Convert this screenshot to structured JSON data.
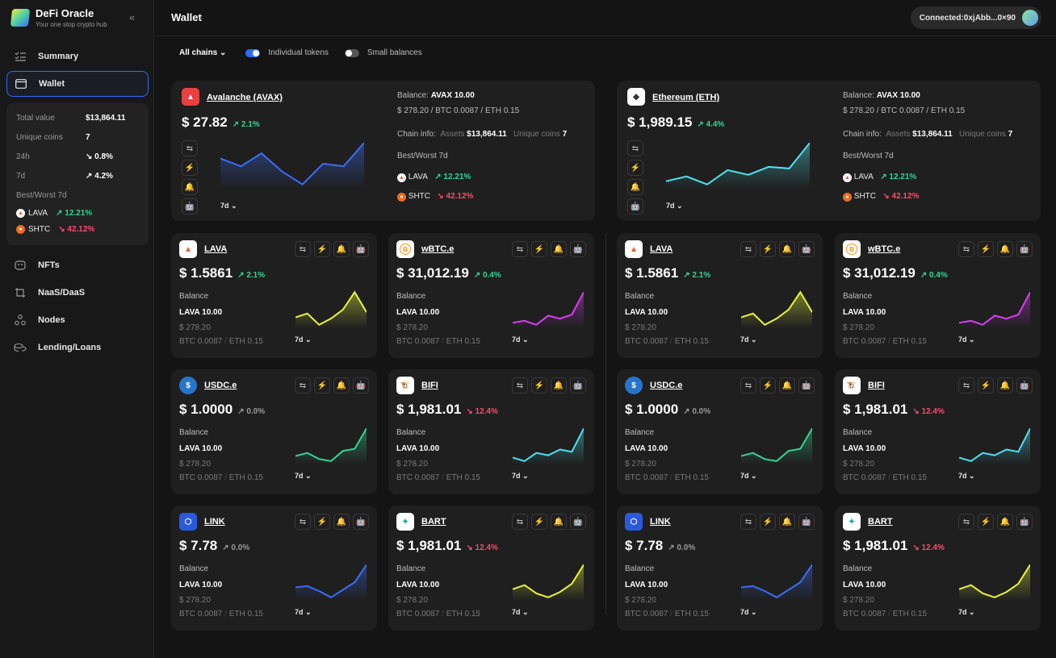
{
  "app": {
    "name": "DeFi Oracle",
    "tagline": "Your one stop crypto hub"
  },
  "nav": [
    {
      "label": "Summary",
      "icon": "checklist-icon"
    },
    {
      "label": "Wallet",
      "icon": "wallet-icon"
    },
    {
      "label": "NFTs",
      "icon": "nft-icon"
    },
    {
      "label": "NaaS/DaaS",
      "icon": "naas-icon"
    },
    {
      "label": "Nodes",
      "icon": "nodes-icon"
    },
    {
      "label": "Lending/Loans",
      "icon": "coins-icon"
    }
  ],
  "summary": {
    "total_label": "Total value",
    "total": "$13,864.11",
    "unique_label": "Unique coins",
    "unique": "7",
    "d24_label": "24h",
    "d24": "↘ 0.8%",
    "d7_label": "7d",
    "d7": "↗ 4.2%",
    "bw_label": "Best/Worst 7d",
    "best_name": "LAVA",
    "best_chg": "↗ 12.21%",
    "worst_name": "SHTC",
    "worst_chg": "↘ 42.12%"
  },
  "header": {
    "title": "Wallet",
    "connected": "Connected:0xjAbb...0×90"
  },
  "filters": {
    "chains": "All chains",
    "individual": "Individual tokens",
    "small": "Small balances"
  },
  "colors": {
    "accent": "#2d6bff",
    "up": "#35d39a",
    "down": "#ff4a6e"
  },
  "period": "7d",
  "balance_label": "Balance",
  "big": [
    {
      "name": "Avalanche (AVAX)",
      "price": "$ 27.82",
      "change": "↗ 2.1%",
      "dir": "up",
      "balance_label": "Balance:",
      "balance": "AVAX 10.00",
      "sub": "$ 278.20 / BTC 0.0087 / ETH 0.15",
      "chain_label": "Chain info:",
      "assets_label": "Assets",
      "assets": "$13,864.11",
      "coins_label": "Unique coins",
      "coins": "7",
      "bw_label": "Best/Worst 7d",
      "best_name": "LAVA",
      "best": "↗ 12.21%",
      "worst_name": "SHTC",
      "worst": "↘ 42.12%",
      "color": "#3b6df6",
      "spark": [
        3.6,
        3.3,
        3.8,
        3.1,
        2.6,
        3.4,
        3.3,
        4.2
      ],
      "logo": "avax"
    },
    {
      "name": "Ethereum (ETH)",
      "price": "$ 1,989.15",
      "change": "↗ 4.4%",
      "dir": "up",
      "balance_label": "Balance:",
      "balance": "AVAX 10.00",
      "sub": "$ 278.20 / BTC 0.0087 / ETH 0.15",
      "chain_label": "Chain info:",
      "assets_label": "Assets",
      "assets": "$13,864.11",
      "coins_label": "Unique coins",
      "coins": "7",
      "bw_label": "Best/Worst 7d",
      "best_name": "LAVA",
      "best": "↗ 12.21%",
      "worst_name": "SHTC",
      "worst": "↘ 42.12%",
      "color": "#4fe3f0",
      "spark": [
        2.2,
        2.5,
        2.0,
        2.9,
        2.6,
        3.1,
        3.0,
        4.6
      ],
      "logo": "eth"
    }
  ],
  "tokens": [
    {
      "name": "LAVA",
      "price": "$ 1.5861",
      "change": "↗ 2.1%",
      "dir": "up",
      "balance": "LAVA 10.00",
      "usd": "$ 278.20",
      "btc": "BTC 0.0087",
      "eth": "ETH 0.15",
      "color": "#e6f53a",
      "spark": [
        3.0,
        3.3,
        2.4,
        2.9,
        3.6,
        5.0,
        3.4
      ],
      "logo": "lava"
    },
    {
      "name": "wBTC.e",
      "price": "$ 31,012.19",
      "change": "↗ 0.4%",
      "dir": "up",
      "balance": "LAVA 10.00",
      "usd": "$ 278.20",
      "btc": "BTC 0.0087",
      "eth": "ETH 0.15",
      "color": "#d63ff2",
      "spark": [
        2.0,
        2.2,
        1.8,
        2.7,
        2.4,
        2.8,
        5.0
      ],
      "logo": "wbtc"
    },
    {
      "name": "USDC.e",
      "price": "$ 1.0000",
      "change": "↗ 0.0%",
      "dir": "flat",
      "balance": "LAVA 10.00",
      "usd": "$ 278.20",
      "btc": "BTC 0.0087",
      "eth": "ETH 0.15",
      "color": "#35d39a",
      "spark": [
        2.3,
        2.6,
        2.0,
        1.8,
        2.8,
        3.0,
        5.0
      ],
      "logo": "usdc"
    },
    {
      "name": "BIFI",
      "price": "$ 1,981.01",
      "change": "↘ 12.4%",
      "dir": "down",
      "balance": "LAVA 10.00",
      "usd": "$ 278.20",
      "btc": "BTC 0.0087",
      "eth": "ETH 0.15",
      "color": "#4fe3f0",
      "spark": [
        2.5,
        2.2,
        2.9,
        2.7,
        3.2,
        3.0,
        5.0
      ],
      "logo": "bifi"
    },
    {
      "name": "LINK",
      "price": "$ 7.78",
      "change": "↗ 0.0%",
      "dir": "flat",
      "balance": "LAVA 10.00",
      "usd": "$ 278.20",
      "btc": "BTC 0.0087",
      "eth": "ETH 0.15",
      "color": "#3b6df6",
      "spark": [
        3.2,
        3.3,
        2.9,
        2.4,
        3.0,
        3.6,
        5.0
      ],
      "logo": "link"
    },
    {
      "name": "BART",
      "price": "$ 1,981.01",
      "change": "↘ 12.4%",
      "dir": "down",
      "balance": "LAVA 10.00",
      "usd": "$ 278.20",
      "btc": "BTC 0.0087",
      "eth": "ETH 0.15",
      "color": "#e6f53a",
      "spark": [
        3.2,
        3.5,
        2.9,
        2.6,
        3.0,
        3.6,
        5.0
      ],
      "logo": "bart"
    }
  ]
}
